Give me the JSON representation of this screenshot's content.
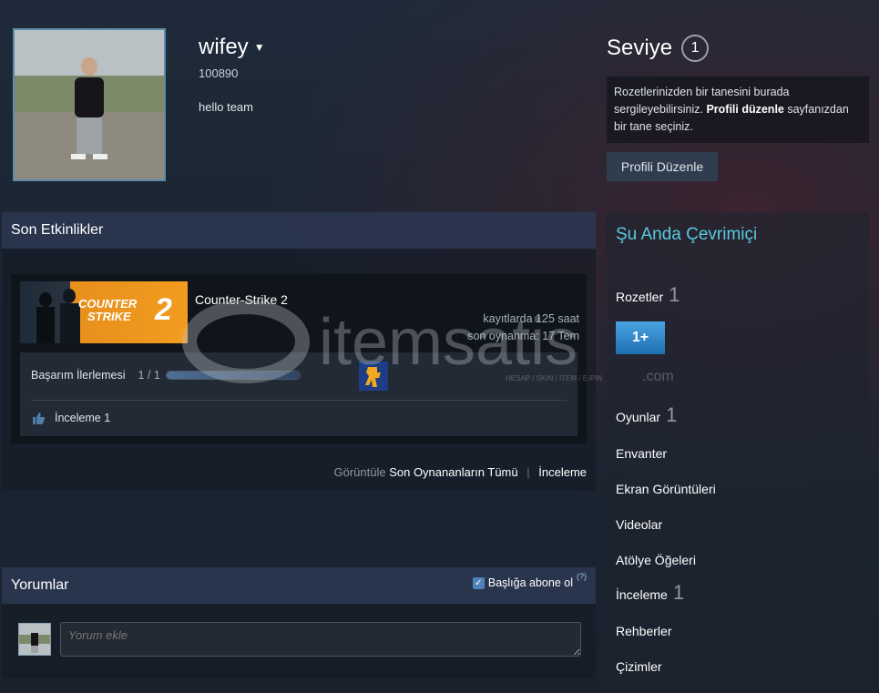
{
  "profile": {
    "persona_name": "wifey",
    "friend_code": "100890",
    "summary": "hello team"
  },
  "level": {
    "title": "Seviye",
    "value": "1",
    "info_pre": "Rozetlerinizden bir tanesini burada sergileyebilirsiniz.",
    "info_link": "Profili düzenle",
    "info_post": "sayfanızdan bir tane seçiniz.",
    "edit_button": "Profili Düzenle"
  },
  "recent": {
    "title": "Son Etkinlikler",
    "game": {
      "name": "Counter-Strike 2",
      "banner_text_1": "COUNTER",
      "banner_text_2": "STRIKE",
      "banner_num": "2",
      "hours": "kayıtlarda 125 saat",
      "last_played": "son oynanma: 17 Tem",
      "achievement_label": "Başarım İlerlemesi",
      "achievement_count": "1 / 1",
      "achievement_progress": 1.0,
      "review_label": "İnceleme 1"
    },
    "footer_view": "Görüntüle",
    "footer_all": "Son Oynananların Tümü",
    "footer_sep": "|",
    "footer_reviews": "İnceleme"
  },
  "comments": {
    "title": "Yorumlar",
    "subscribe_label": "Başlığa abone ol",
    "help": "(?)",
    "placeholder": "Yorum ekle"
  },
  "sidebar": {
    "online_status": "Şu Anda Çevrimiçi",
    "badges_label": "Rozetler",
    "badges_count": "1",
    "badge_text": "1+",
    "games_label": "Oyunlar",
    "games_count": "1",
    "inventory": "Envanter",
    "screenshots": "Ekran Görüntüleri",
    "videos": "Videolar",
    "workshop": "Atölye Öğeleri",
    "reviews_label": "İnceleme",
    "reviews_count": "1",
    "guides": "Rehberler",
    "artwork": "Çizimler"
  },
  "watermark": {
    "brand": "itemsatis",
    "tagline": "HESAP / SKIN / ITEM / E-PIN",
    "suffix": ".com"
  },
  "colors": {
    "accent_online": "#57cbde",
    "panel_head": "#303e5a",
    "badge_blue": "#1e6fb0"
  }
}
